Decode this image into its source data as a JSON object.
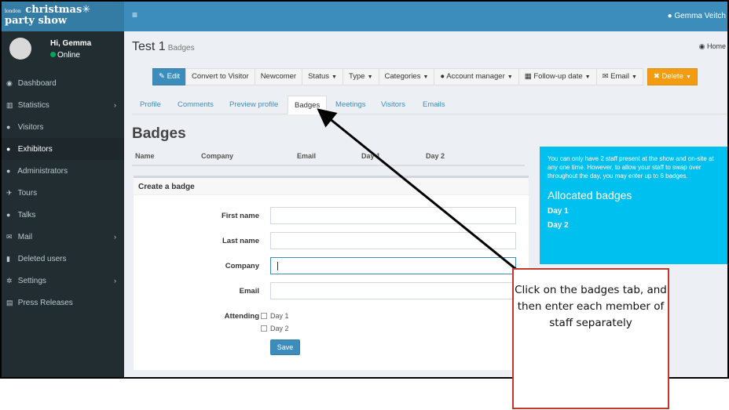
{
  "logo": {
    "small": "london",
    "line1": "christmas",
    "star": "✳",
    "line2": "party show"
  },
  "sidebar": {
    "user_name": "Hi, Gemma",
    "user_status": "Online",
    "items": [
      {
        "label": "Dashboard",
        "icon": "dashboard-icon"
      },
      {
        "label": "Statistics",
        "icon": "bar-chart-icon"
      },
      {
        "label": "Visitors",
        "icon": "user-icon"
      },
      {
        "label": "Exhibitors",
        "icon": "user-icon"
      },
      {
        "label": "Administrators",
        "icon": "user-icon"
      },
      {
        "label": "Tours",
        "icon": "tour-icon"
      },
      {
        "label": "Talks",
        "icon": "comment-icon"
      },
      {
        "label": "Mail",
        "icon": "envelope-icon"
      },
      {
        "label": "Deleted users",
        "icon": "trash-icon"
      },
      {
        "label": "Settings",
        "icon": "gear-icon"
      },
      {
        "label": "Press Releases",
        "icon": "newspaper-icon"
      }
    ]
  },
  "topbar": {
    "user": "Gemma Veitch"
  },
  "page": {
    "title": "Test 1",
    "subtitle": "Badges",
    "crumb": "Home"
  },
  "toolbar": {
    "edit": "Edit",
    "convert": "Convert to Visitor",
    "newcomer": "Newcomer",
    "status": "Status",
    "type": "Type",
    "categories": "Categories",
    "account_manager": "Account manager",
    "followup": "Follow-up date",
    "email": "Email",
    "delete": "Delete"
  },
  "tabs": [
    "Profile",
    "Comments",
    "Preview profile",
    "Badges",
    "Meetings",
    "Visitors",
    "Emails"
  ],
  "section_title": "Badges",
  "columns": [
    "Name",
    "Company",
    "Email",
    "Day 1",
    "Day 2"
  ],
  "form": {
    "header": "Create a badge",
    "first_name": "First name",
    "last_name": "Last name",
    "company": "Company",
    "email": "Email",
    "attending": "Attending",
    "day1": "Day 1",
    "day2": "Day 2",
    "save": "Save"
  },
  "info": {
    "text": "You can only have 2 staff present at the show and on-site at any one time. However, to allow your staff to swap over throughout the day, you may enter up to 6 badges.",
    "heading": "Allocated badges",
    "day1": "Day 1",
    "day2": "Day 2"
  },
  "callout": "Click on the badges tab, and then enter each member of staff separately",
  "colors": {
    "sidebar": "#222d32",
    "topbar": "#3c8dbc",
    "info": "#00c0ef",
    "delete": "#f39c12",
    "callout_border": "#c0392b"
  }
}
